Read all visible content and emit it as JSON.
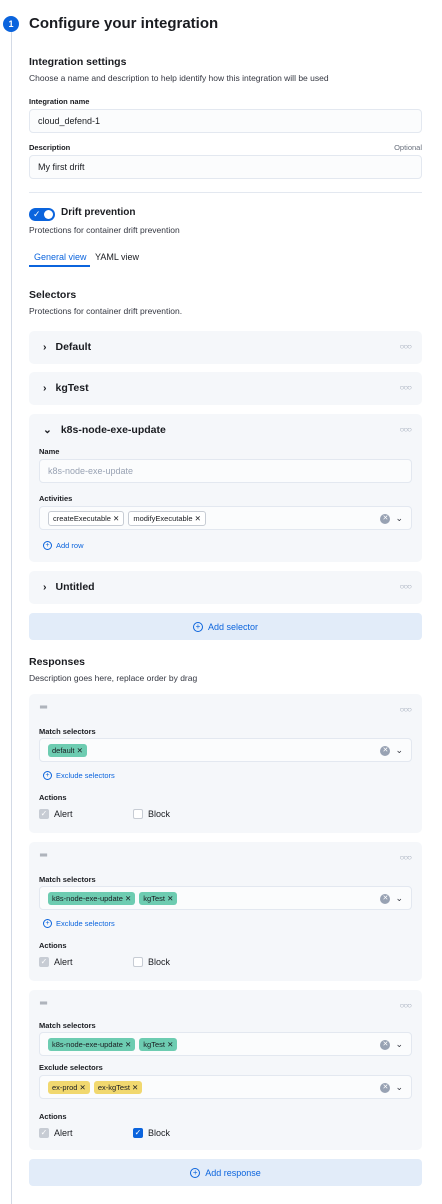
{
  "step": {
    "number": "1",
    "title": "Configure your integration"
  },
  "settings": {
    "title": "Integration settings",
    "description": "Choose a name and description to help identify how this integration will be used",
    "name_label": "Integration name",
    "name_value": "cloud_defend-1",
    "desc_label": "Description",
    "desc_optional": "Optional",
    "desc_value": "My first drift"
  },
  "drift": {
    "enabled": true,
    "label": "Drift prevention",
    "description": "Protections for container drift prevention"
  },
  "tabs": [
    {
      "label": "General view",
      "active": true
    },
    {
      "label": "YAML view",
      "active": false
    }
  ],
  "selectors": {
    "title": "Selectors",
    "description": "Protections for container drift prevention.",
    "items": [
      {
        "name": "Default"
      },
      {
        "name": "kgTest"
      },
      {
        "name": "k8s-node-exe-update",
        "name_label": "Name",
        "name_placeholder": "k8s-node-exe-update",
        "activities_label": "Activities",
        "activities": [
          "createExecutable",
          "modifyExecutable"
        ],
        "add_row": "Add row"
      },
      {
        "name": "Untitled"
      }
    ],
    "add_label": "Add selector"
  },
  "responses": {
    "title": "Responses",
    "description": "Description goes here, replace order by drag",
    "match_label": "Match selectors",
    "exclude_link": "Exclude selectors",
    "exclude_label": "Exclude selectors",
    "actions_label": "Actions",
    "alert_label": "Alert",
    "block_label": "Block",
    "items": [
      {
        "match": [
          "default"
        ],
        "exclude": [],
        "alert": true,
        "block": false
      },
      {
        "match": [
          "k8s-node-exe-update",
          "kgTest"
        ],
        "exclude": [],
        "alert": true,
        "block": false
      },
      {
        "match": [
          "k8s-node-exe-update",
          "kgTest"
        ],
        "exclude": [
          "ex-prod",
          "ex-kgTest"
        ],
        "alert": true,
        "block": true
      }
    ],
    "add_label": "Add response"
  },
  "colors": {
    "accent": "#0b64dd",
    "green_tag": "#6dccb1",
    "yellow_tag": "#f1d86f"
  }
}
